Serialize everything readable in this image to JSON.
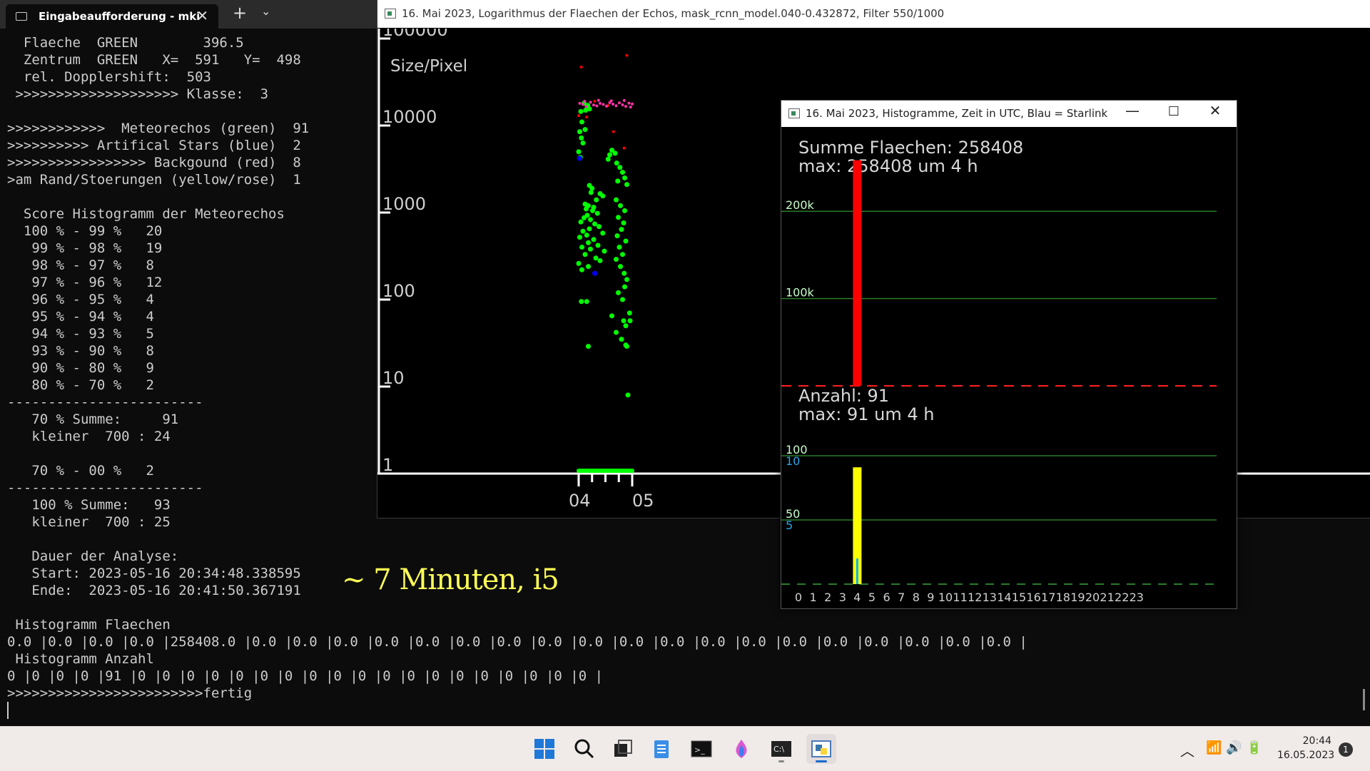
{
  "terminal": {
    "tab_title": "Eingabeaufforderung - mki",
    "tab_close": "✕",
    "new_tab": "+",
    "dropdown": "⌄",
    "lines": [
      "  Flaeche  GREEN        396.5",
      "  Zentrum  GREEN   X=  591   Y=  498",
      "  rel. Dopplershift:  503",
      " >>>>>>>>>>>>>>>>>>>> Klasse:  3",
      "",
      ">>>>>>>>>>>>  Meteorechos (green)  91",
      ">>>>>>>>>> Artifical Stars (blue)  2",
      ">>>>>>>>>>>>>>>>> Backgound (red)  8",
      ">am Rand/Stoerungen (yellow/rose)  1",
      "",
      "  Score Histogramm der Meteorechos",
      "  100 % - 99 %   20",
      "   99 % - 98 %   19",
      "   98 % - 97 %   8",
      "   97 % - 96 %   12",
      "   96 % - 95 %   4",
      "   95 % - 94 %   4",
      "   94 % - 93 %   5",
      "   93 % - 90 %   8",
      "   90 % - 80 %   9",
      "   80 % - 70 %   2",
      "------------------------",
      "   70 % Summe:     91",
      "   kleiner  700 : 24",
      "",
      "   70 % - 00 %   2",
      "------------------------",
      "   100 % Summe:   93",
      "   kleiner  700 : 25",
      "",
      "   Dauer der Analyse:",
      "   Start: 2023-05-16 20:34:48.338595",
      "   Ende:  2023-05-16 20:41:50.367191",
      "",
      " Histogramm Flaechen",
      "0.0 |0.0 |0.0 |0.0 |258408.0 |0.0 |0.0 |0.0 |0.0 |0.0 |0.0 |0.0 |0.0 |0.0 |0.0 |0.0 |0.0 |0.0 |0.0 |0.0 |0.0 |0.0 |0.0 |0.0 |",
      " Histogramm Anzahl",
      "0 |0 |0 |0 |91 |0 |0 |0 |0 |0 |0 |0 |0 |0 |0 |0 |0 |0 |0 |0 |0 |0 |0 |0 |",
      ">>>>>>>>>>>>>>>>>>>>>>>>fertig"
    ]
  },
  "annotation": "~ 7 Minuten, i5",
  "window_log": {
    "title": "16. Mai 2023, Logarithmus der Flaechen der Echos, mask_rcnn_model.040-0.432872, Filter 550/1000",
    "chart_data": {
      "type": "scatter",
      "ylabel": "Size/Pixel",
      "yscale": "log",
      "y_ticks": [
        "1",
        "10",
        "100",
        "1000",
        "10000",
        "100000"
      ],
      "x_ticks": [
        "04",
        "05"
      ],
      "ylim": [
        1,
        100000
      ],
      "colors": {
        "meteor": "#00ff00",
        "star": "#0000ff",
        "background": "#ff0000",
        "disturbance": "#ff33aa"
      },
      "series": [
        {
          "name": "Meteorechos (green)",
          "points": [
            [
              4.1,
              18000
            ],
            [
              4.13,
              15000
            ],
            [
              4.17,
              17000
            ],
            [
              4.2,
              15500
            ],
            [
              4.04,
              14500
            ],
            [
              4.06,
              11000
            ],
            [
              4.12,
              9000
            ],
            [
              4.02,
              8500
            ],
            [
              4.05,
              7200
            ],
            [
              4.08,
              6300
            ],
            [
              4.0,
              5000
            ],
            [
              4.03,
              4300
            ],
            [
              4.58,
              4600
            ],
            [
              4.62,
              5200
            ],
            [
              4.68,
              4800
            ],
            [
              4.55,
              4100
            ],
            [
              4.71,
              3700
            ],
            [
              4.77,
              3300
            ],
            [
              4.82,
              2900
            ],
            [
              4.86,
              2500
            ],
            [
              4.73,
              2300
            ],
            [
              4.9,
              2100
            ],
            [
              4.2,
              2050
            ],
            [
              4.25,
              1900
            ],
            [
              4.23,
              1700
            ],
            [
              4.4,
              1650
            ],
            [
              4.45,
              1550
            ],
            [
              4.33,
              1400
            ],
            [
              4.12,
              1250
            ],
            [
              4.18,
              1200
            ],
            [
              4.28,
              1150
            ],
            [
              4.14,
              1100
            ],
            [
              4.26,
              1050
            ],
            [
              4.35,
              980
            ],
            [
              4.16,
              930
            ],
            [
              4.1,
              870
            ],
            [
              4.22,
              830
            ],
            [
              4.04,
              780
            ],
            [
              4.3,
              740
            ],
            [
              4.38,
              690
            ],
            [
              4.2,
              650
            ],
            [
              4.08,
              610
            ],
            [
              4.45,
              580
            ],
            [
              4.15,
              550
            ],
            [
              4.02,
              520
            ],
            [
              4.28,
              490
            ],
            [
              4.18,
              450
            ],
            [
              4.36,
              420
            ],
            [
              4.06,
              400
            ],
            [
              4.22,
              380
            ],
            [
              4.48,
              360
            ],
            [
              4.12,
              330
            ],
            [
              4.32,
              300
            ],
            [
              4.4,
              280
            ],
            [
              4.0,
              260
            ],
            [
              4.18,
              240
            ],
            [
              4.06,
              220
            ],
            [
              4.7,
              1400
            ],
            [
              4.78,
              1200
            ],
            [
              4.86,
              1050
            ],
            [
              4.74,
              880
            ],
            [
              4.84,
              760
            ],
            [
              4.8,
              640
            ],
            [
              4.72,
              540
            ],
            [
              4.88,
              470
            ],
            [
              4.76,
              400
            ],
            [
              4.82,
              330
            ],
            [
              4.7,
              290
            ],
            [
              4.78,
              240
            ],
            [
              4.85,
              200
            ],
            [
              4.9,
              170
            ],
            [
              4.86,
              140
            ],
            [
              4.74,
              120
            ],
            [
              4.82,
              100
            ],
            [
              4.95,
              70
            ],
            [
              4.62,
              65
            ],
            [
              4.88,
              50
            ],
            [
              4.7,
              42
            ],
            [
              4.8,
              35
            ],
            [
              4.05,
              95
            ],
            [
              4.15,
              95
            ],
            [
              4.84,
              57
            ],
            [
              4.96,
              57
            ],
            [
              4.88,
              30
            ],
            [
              4.9,
              29
            ],
            [
              4.18,
              29
            ],
            [
              4.92,
              8
            ]
          ]
        },
        {
          "name": "Artifical Stars (blue)",
          "points": [
            [
              4.02,
              4200
            ],
            [
              4.3,
              200
            ]
          ]
        },
        {
          "name": "Backgound (red)",
          "points": [
            [
              4.05,
              47000
            ],
            [
              4.9,
              64000
            ],
            [
              4.15,
              12500
            ],
            [
              4.65,
              8500
            ],
            [
              4.85,
              5500
            ],
            [
              4.3,
              19000
            ],
            [
              4.55,
              17000
            ],
            [
              4.0,
              13000
            ]
          ]
        },
        {
          "name": "am Rand/Stoerungen (yellow/rose)",
          "points": [
            [
              4.02,
              18000
            ],
            [
              4.08,
              17500
            ],
            [
              4.14,
              16500
            ],
            [
              4.22,
              18500
            ],
            [
              4.28,
              17200
            ],
            [
              4.34,
              16800
            ],
            [
              4.4,
              18000
            ],
            [
              4.46,
              17500
            ],
            [
              4.52,
              16700
            ],
            [
              4.58,
              18300
            ],
            [
              4.64,
              17600
            ],
            [
              4.7,
              16900
            ],
            [
              4.76,
              18200
            ],
            [
              4.82,
              17300
            ],
            [
              4.88,
              16600
            ],
            [
              4.94,
              18100
            ],
            [
              5.0,
              17700
            ],
            [
              4.11,
              19000
            ],
            [
              4.37,
              19500
            ],
            [
              4.61,
              19200
            ],
            [
              4.85,
              19400
            ],
            [
              4.97,
              16300
            ]
          ]
        }
      ]
    }
  },
  "window_hist": {
    "title": "16. Mai 2023, Histogramme, Zeit in UTC, Blau = Starlink",
    "minimize": "—",
    "maximize": "☐",
    "close": "✕",
    "chart_data": [
      {
        "type": "bar",
        "title": "Summe Flaechen: 258408",
        "subtitle": "max: 258408 um 4 h",
        "categories": [
          "0",
          "1",
          "2",
          "3",
          "4",
          "5",
          "6",
          "7",
          "8",
          "9",
          "10",
          "11",
          "12",
          "13",
          "14",
          "15",
          "16",
          "17",
          "18",
          "19",
          "20",
          "21",
          "22",
          "23"
        ],
        "values": [
          0,
          0,
          0,
          0,
          258408,
          0,
          0,
          0,
          0,
          0,
          0,
          0,
          0,
          0,
          0,
          0,
          0,
          0,
          0,
          0,
          0,
          0,
          0,
          0
        ],
        "y_ticks": [
          "100k",
          "200k"
        ],
        "ylim": [
          0,
          250000
        ],
        "color": "#ff0000",
        "grid_color": "#2a7a2a"
      },
      {
        "type": "bar",
        "title": "Anzahl: 91",
        "subtitle": "max: 91 um 4 h",
        "categories": [
          "0",
          "1",
          "2",
          "3",
          "4",
          "5",
          "6",
          "7",
          "8",
          "9",
          "10",
          "11",
          "12",
          "13",
          "14",
          "15",
          "16",
          "17",
          "18",
          "19",
          "20",
          "21",
          "22",
          "23"
        ],
        "series": [
          {
            "name": "Anzahl",
            "values": [
              0,
              0,
              0,
              0,
              91,
              0,
              0,
              0,
              0,
              0,
              0,
              0,
              0,
              0,
              0,
              0,
              0,
              0,
              0,
              0,
              0,
              0,
              0,
              0
            ],
            "color": "#ffff00"
          },
          {
            "name": "Starlink",
            "values": [
              0,
              0,
              0,
              0,
              2,
              0,
              0,
              0,
              0,
              0,
              0,
              0,
              0,
              0,
              0,
              0,
              0,
              0,
              0,
              0,
              0,
              0,
              0,
              0
            ],
            "color": "#00b0ff"
          }
        ],
        "y_ticks": [
          "50",
          "100"
        ],
        "y_ticks_secondary": [
          "5",
          "10"
        ],
        "ylim": [
          0,
          100
        ],
        "ylim_secondary": [
          0,
          10
        ],
        "grid_color": "#2a7a2a"
      }
    ]
  },
  "taskbar": {
    "apps": [
      "start-icon",
      "search-icon",
      "task-view-icon",
      "notepad-icon",
      "terminal-icon",
      "paint-icon",
      "console-icon",
      "python-icon"
    ],
    "tray_chevron": "︿",
    "tray_icons": "📶🔊🔋",
    "time": "20:44",
    "date": "16.05.2023",
    "badge": "1"
  }
}
